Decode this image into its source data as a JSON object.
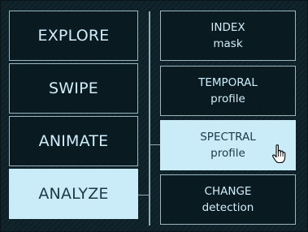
{
  "main_menu": [
    {
      "label": "EXPLORE"
    },
    {
      "label": "SWIPE"
    },
    {
      "label": "ANIMATE"
    },
    {
      "label": "ANALYZE"
    }
  ],
  "sub_menu": [
    {
      "line1": "INDEX",
      "line2": "mask"
    },
    {
      "line1": "TEMPORAL",
      "line2": "profile"
    },
    {
      "line1": "SPECTRAL",
      "line2": "profile"
    },
    {
      "line1": "CHANGE",
      "line2": "detection"
    }
  ],
  "selected": {
    "main": "ANALYZE",
    "sub": "SPECTRAL"
  },
  "colors": {
    "background": "#0e2129",
    "button_border": "#9ab7c1",
    "button_text": "#cfeefa",
    "active_fill": "#c9ecf8",
    "active_text": "#1c3a47"
  },
  "icons": {
    "cursor": "hand-pointer-icon"
  }
}
